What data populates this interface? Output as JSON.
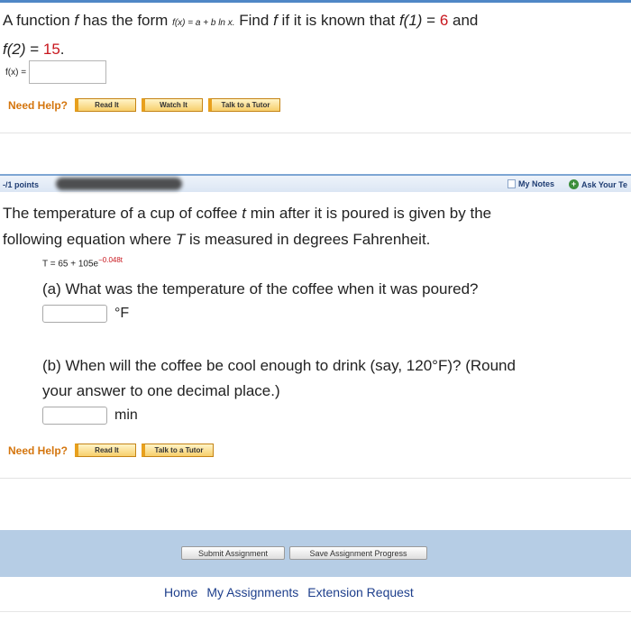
{
  "question1": {
    "text_a": "A function ",
    "f": "f",
    "text_b": " has the form ",
    "formula": "f(x) = a + b ln x.",
    "text_c": " Find ",
    "text_d": " if it is known that ",
    "f1": "f(1)",
    "eq1": " = ",
    "v1": "6",
    "text_e": " and",
    "f2": "f(2)",
    "eq2": " = ",
    "v2": "15",
    "period": ".",
    "answer_label": "f(x) =",
    "answer_value": ""
  },
  "help1": {
    "label": "Need Help?",
    "buttons": [
      "Read It",
      "Watch It",
      "Talk to a Tutor"
    ]
  },
  "question2_header": {
    "points": "-/1 points",
    "my_notes": "My Notes",
    "ask": "Ask Your Te"
  },
  "question2": {
    "intro_1": "The temperature of a cup of coffee ",
    "t": "t",
    "intro_2": " min after it is poured is given by the",
    "intro_3": "following equation where ",
    "T": "T",
    "intro_4": " is measured in degrees Fahrenheit.",
    "equation_base": "T = 65 + 105e",
    "equation_exp": "−0.048t",
    "part_a": "(a) What was the temperature of the coffee when it was poured?",
    "unit_a": "°F",
    "part_b_1": "(b) When will the coffee be cool enough to drink (say, 120°F)? (Round",
    "part_b_2": "your answer to one decimal place.)",
    "unit_b": "min"
  },
  "help2": {
    "label": "Need Help?",
    "buttons": [
      "Read It",
      "Talk to a Tutor"
    ]
  },
  "footer": {
    "submit": "Submit Assignment",
    "save": "Save Assignment Progress"
  },
  "links": [
    "Home",
    "My Assignments",
    "Extension Request"
  ],
  "colors": {
    "accent_blue": "#4f87c6",
    "help_orange": "#d4750d",
    "value_red": "#c8161d",
    "footer_bg": "#b6cde5",
    "link_blue": "#1e3f8c"
  }
}
